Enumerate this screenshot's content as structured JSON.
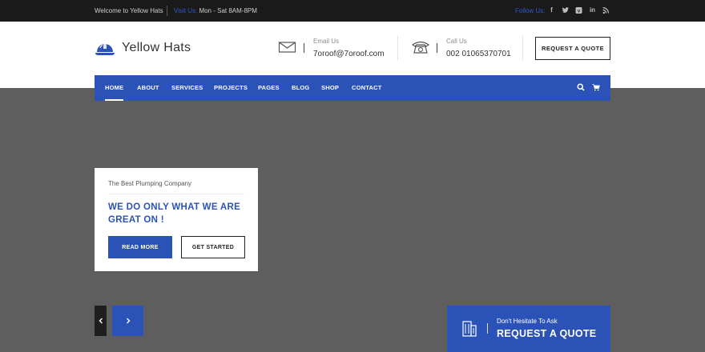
{
  "topbar": {
    "welcome": "Welcome to Yellow Hats",
    "visit_label": "Visit Us:",
    "visit_hours": "Mon - Sat 8AM-8PM",
    "follow_label": "Follow Us:",
    "socials": [
      "facebook-icon",
      "twitter-icon",
      "vimeo-icon",
      "linkedin-icon",
      "rss-icon"
    ]
  },
  "header": {
    "logo_text": "Yellow Hats",
    "email_label": "Email Us",
    "email_value": "7oroof@7oroof.com",
    "call_label": "Call Us",
    "call_value": "002 01065370701",
    "quote_button": "REQUEST A QUOTE"
  },
  "nav": {
    "items": [
      "HOME",
      "ABOUT",
      "SERVICES",
      "PROJECTS",
      "PAGES",
      "BLOG",
      "SHOP",
      "CONTACT"
    ],
    "active": "HOME"
  },
  "hero": {
    "tagline": "The Best Plumping Company",
    "headline_1": "WE DO ONLY WHAT WE ARE",
    "headline_2": "GREAT ON !",
    "read_more": "READ MORE",
    "get_started": "GET STARTED"
  },
  "cta": {
    "small": "Don't Hesitate To Ask",
    "big": "REQUEST A QUOTE"
  },
  "colors": {
    "brand_blue": "#2b53b7",
    "topbar": "#1a1a1a",
    "hero_bg": "#5e5e5e"
  }
}
